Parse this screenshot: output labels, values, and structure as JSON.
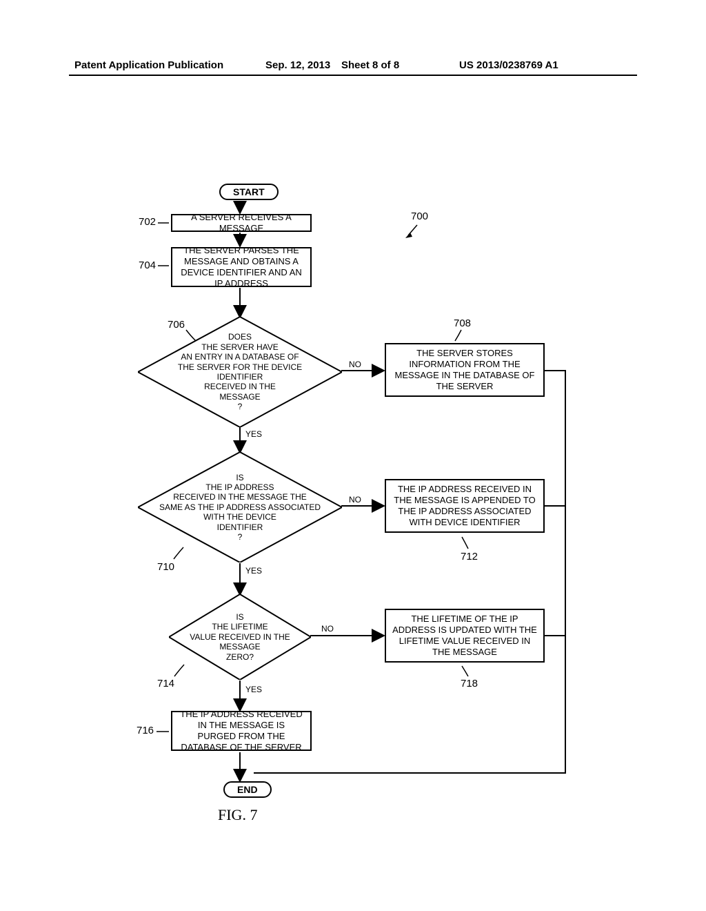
{
  "header": {
    "pub_type": "Patent Application Publication",
    "date": "Sep. 12, 2013",
    "sheet": "Sheet 8 of 8",
    "pub_number": "US 2013/0238769 A1"
  },
  "terminators": {
    "start": "START",
    "end": "END"
  },
  "boxes": {
    "b702": "A SERVER RECEIVES A MESSAGE",
    "b704": "THE SERVER PARSES THE MESSAGE AND OBTAINS A DEVICE IDENTIFIER AND AN IP ADDRESS",
    "b708": "THE SERVER STORES INFORMATION FROM THE MESSAGE IN THE DATABASE OF THE SERVER",
    "b712": "THE IP ADDRESS RECEIVED IN THE MESSAGE IS APPENDED TO THE IP ADDRESS ASSOCIATED WITH DEVICE IDENTIFIER",
    "b716": "THE IP ADDRESS RECEIVED IN THE MESSAGE IS PURGED FROM THE DATABASE OF THE SERVER",
    "b718": "THE LIFETIME OF THE IP ADDRESS IS UPDATED WITH THE LIFETIME VALUE RECEIVED IN THE MESSAGE"
  },
  "diamonds": {
    "d706": "DOES\nTHE SERVER HAVE\nAN ENTRY IN A DATABASE OF\nTHE SERVER FOR THE DEVICE IDENTIFIER\nRECEIVED IN THE\nMESSAGE\n?",
    "d710": "IS\nTHE IP ADDRESS\nRECEIVED IN THE MESSAGE THE\nSAME AS THE IP ADDRESS ASSOCIATED\nWITH THE DEVICE\nIDENTIFIER\n?",
    "d714": "IS\nTHE LIFETIME\nVALUE RECEIVED IN THE\nMESSAGE\nZERO?"
  },
  "edges": {
    "yes": "YES",
    "no": "NO"
  },
  "refs": {
    "r700": "700",
    "r702": "702",
    "r704": "704",
    "r706": "706",
    "r708": "708",
    "r710": "710",
    "r712": "712",
    "r714": "714",
    "r716": "716",
    "r718": "718"
  },
  "figure": "FIG. 7"
}
